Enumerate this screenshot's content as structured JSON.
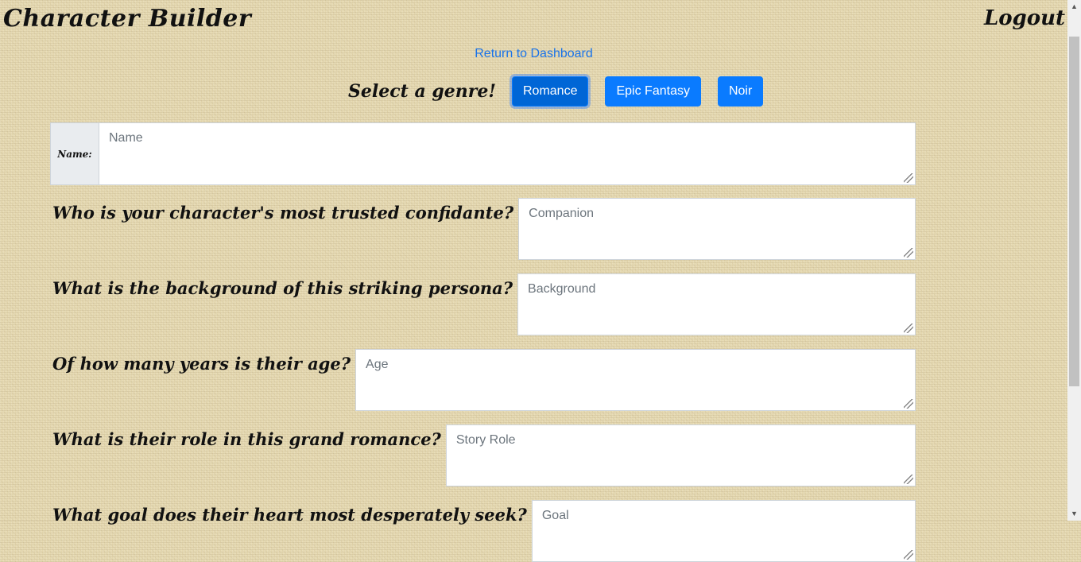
{
  "header": {
    "brand": "Character Builder",
    "logout": "Logout"
  },
  "dashboard_link": "Return to Dashboard",
  "genre": {
    "label": "Select a genre!",
    "options": [
      "Romance",
      "Epic Fantasy",
      "Noir"
    ],
    "selected": "Romance"
  },
  "form": {
    "name_label": "Name:",
    "name_placeholder": "Name",
    "questions": [
      {
        "label": "Who is your character's most trusted confidante?",
        "placeholder": "Companion"
      },
      {
        "label": "What is the background of this striking persona?",
        "placeholder": "Background"
      },
      {
        "label": "Of how many years is their age?",
        "placeholder": "Age"
      },
      {
        "label": "What is their role in this grand romance?",
        "placeholder": "Story Role"
      },
      {
        "label": "What goal does their heart most desperately seek?",
        "placeholder": "Goal"
      }
    ]
  },
  "icons": {
    "scroll_up": "triangle-up",
    "scroll_down": "triangle-down"
  }
}
